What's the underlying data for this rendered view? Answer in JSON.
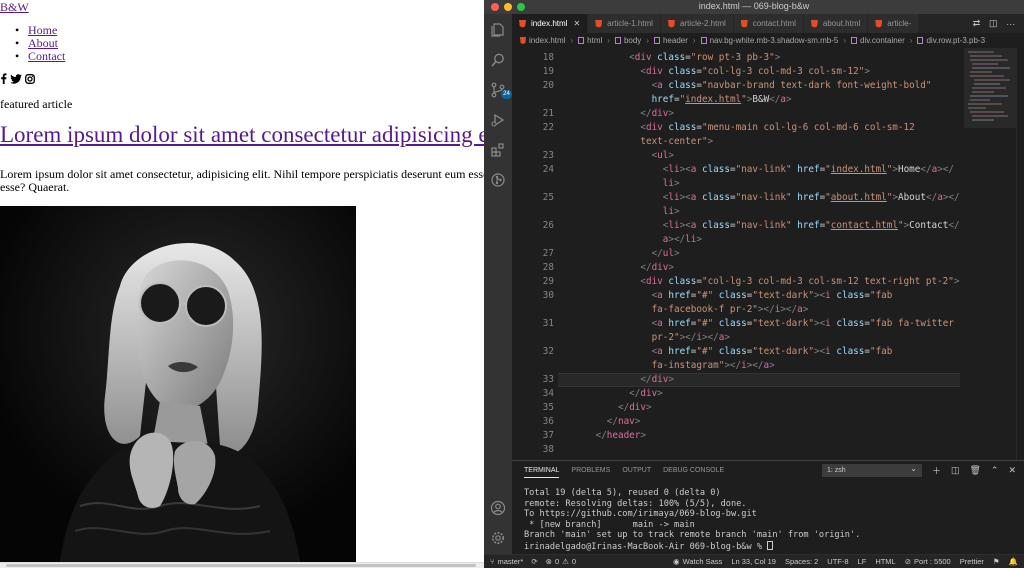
{
  "browser": {
    "brand": "B&W",
    "nav_items": [
      "Home",
      "About",
      "Contact"
    ],
    "social_icons": [
      "facebook-icon",
      "twitter-icon",
      "instagram-icon"
    ],
    "featured_label": "featured article",
    "headline": "Lorem ipsum dolor sit amet consectetur adipisicing elit.",
    "lead": "Lorem ipsum dolor sit amet consectetur, adipisicing elit. Nihil tempore perspiciatis deserunt eum esse animi. Quis, esse? Quaerat."
  },
  "vscode": {
    "window_title": "index.html — 069-blog-b&w",
    "tabs": [
      {
        "label": "index.html",
        "active": true
      },
      {
        "label": "article-1.html",
        "active": false
      },
      {
        "label": "article-2.html",
        "active": false
      },
      {
        "label": "contact.html",
        "active": false
      },
      {
        "label": "about.html",
        "active": false
      },
      {
        "label": "article-",
        "active": false
      }
    ],
    "scm_badge": "24",
    "breadcrumb": [
      "index.html",
      "html",
      "body",
      "header",
      "nav.bg-white.mb-3.shadow-sm.mb-5",
      "div.container",
      "div.row.pt-3.pb-3"
    ],
    "code_lines": [
      {
        "n": "18",
        "t": [
          [
            "            ",
            ""
          ],
          [
            "<",
            "pun"
          ],
          [
            "div",
            "tag"
          ],
          [
            " class",
            "attr"
          ],
          [
            "=",
            "text"
          ],
          [
            "\"row pt-3 pb-3\"",
            "str"
          ],
          [
            ">",
            "pun"
          ]
        ]
      },
      {
        "n": "19",
        "t": [
          [
            "              ",
            ""
          ],
          [
            "<",
            "pun"
          ],
          [
            "div",
            "tag"
          ],
          [
            " class",
            "attr"
          ],
          [
            "=",
            "text"
          ],
          [
            "\"col-lg-3 col-md-3 col-sm-12\"",
            "str"
          ],
          [
            ">",
            "pun"
          ]
        ]
      },
      {
        "n": "20",
        "t": [
          [
            "                ",
            ""
          ],
          [
            "<",
            "pun"
          ],
          [
            "a",
            "tag"
          ],
          [
            " class",
            "attr"
          ],
          [
            "=",
            "text"
          ],
          [
            "\"navbar-brand text-dark font-weight-bold\"",
            "str"
          ]
        ]
      },
      {
        "n": "",
        "t": [
          [
            "                ",
            ""
          ],
          [
            "href",
            "attr"
          ],
          [
            "=",
            "text"
          ],
          [
            "\"",
            "str"
          ],
          [
            "index.html",
            "link"
          ],
          [
            "\"",
            "str"
          ],
          [
            ">",
            "pun"
          ],
          [
            "B&W",
            "text"
          ],
          [
            "</",
            "pun"
          ],
          [
            "a",
            "tag"
          ],
          [
            ">",
            "pun"
          ]
        ]
      },
      {
        "n": "21",
        "t": [
          [
            "              ",
            ""
          ],
          [
            "</",
            "pun"
          ],
          [
            "div",
            "tag"
          ],
          [
            ">",
            "pun"
          ]
        ]
      },
      {
        "n": "22",
        "t": [
          [
            "              ",
            ""
          ],
          [
            "<",
            "pun"
          ],
          [
            "div",
            "tag"
          ],
          [
            " class",
            "attr"
          ],
          [
            "=",
            "text"
          ],
          [
            "\"menu-main col-lg-6 col-md-6 col-sm-12",
            "str"
          ]
        ]
      },
      {
        "n": "",
        "t": [
          [
            "              ",
            ""
          ],
          [
            "text-center\"",
            "str"
          ],
          [
            ">",
            "pun"
          ]
        ]
      },
      {
        "n": "23",
        "t": [
          [
            "                ",
            ""
          ],
          [
            "<",
            "pun"
          ],
          [
            "ul",
            "tag"
          ],
          [
            ">",
            "pun"
          ]
        ]
      },
      {
        "n": "24",
        "t": [
          [
            "                  ",
            ""
          ],
          [
            "<",
            "pun"
          ],
          [
            "li",
            "tag"
          ],
          [
            "><",
            "pun"
          ],
          [
            "a",
            "tag"
          ],
          [
            " class",
            "attr"
          ],
          [
            "=",
            "text"
          ],
          [
            "\"nav-link\"",
            "str"
          ],
          [
            " href",
            "attr"
          ],
          [
            "=",
            "text"
          ],
          [
            "\"",
            "str"
          ],
          [
            "index.html",
            "link"
          ],
          [
            "\"",
            "str"
          ],
          [
            ">",
            "pun"
          ],
          [
            "Home",
            "text"
          ],
          [
            "</",
            "pun"
          ],
          [
            "a",
            "tag"
          ],
          [
            "></",
            "pun"
          ]
        ]
      },
      {
        "n": "",
        "t": [
          [
            "                  ",
            ""
          ],
          [
            "li",
            "tag"
          ],
          [
            ">",
            "pun"
          ]
        ]
      },
      {
        "n": "25",
        "t": [
          [
            "                  ",
            ""
          ],
          [
            "<",
            "pun"
          ],
          [
            "li",
            "tag"
          ],
          [
            "><",
            "pun"
          ],
          [
            "a",
            "tag"
          ],
          [
            " class",
            "attr"
          ],
          [
            "=",
            "text"
          ],
          [
            "\"nav-link\"",
            "str"
          ],
          [
            " href",
            "attr"
          ],
          [
            "=",
            "text"
          ],
          [
            "\"",
            "str"
          ],
          [
            "about.html",
            "link"
          ],
          [
            "\"",
            "str"
          ],
          [
            ">",
            "pun"
          ],
          [
            "About",
            "text"
          ],
          [
            "</",
            "pun"
          ],
          [
            "a",
            "tag"
          ],
          [
            "></",
            "pun"
          ]
        ]
      },
      {
        "n": "",
        "t": [
          [
            "                  ",
            ""
          ],
          [
            "li",
            "tag"
          ],
          [
            ">",
            "pun"
          ]
        ]
      },
      {
        "n": "26",
        "t": [
          [
            "                  ",
            ""
          ],
          [
            "<",
            "pun"
          ],
          [
            "li",
            "tag"
          ],
          [
            "><",
            "pun"
          ],
          [
            "a",
            "tag"
          ],
          [
            " class",
            "attr"
          ],
          [
            "=",
            "text"
          ],
          [
            "\"nav-link\"",
            "str"
          ],
          [
            " href",
            "attr"
          ],
          [
            "=",
            "text"
          ],
          [
            "\"",
            "str"
          ],
          [
            "contact.html",
            "link"
          ],
          [
            "\"",
            "str"
          ],
          [
            ">",
            "pun"
          ],
          [
            "Contact",
            "text"
          ],
          [
            "</",
            "pun"
          ]
        ]
      },
      {
        "n": "",
        "t": [
          [
            "                  ",
            ""
          ],
          [
            "a",
            "tag"
          ],
          [
            "></",
            "pun"
          ],
          [
            "li",
            "tag"
          ],
          [
            ">",
            "pun"
          ]
        ]
      },
      {
        "n": "27",
        "t": [
          [
            "                ",
            ""
          ],
          [
            "</",
            "pun"
          ],
          [
            "ul",
            "tag"
          ],
          [
            ">",
            "pun"
          ]
        ]
      },
      {
        "n": "28",
        "t": [
          [
            "              ",
            ""
          ],
          [
            "</",
            "pun"
          ],
          [
            "div",
            "tag"
          ],
          [
            ">",
            "pun"
          ]
        ]
      },
      {
        "n": "29",
        "t": [
          [
            "              ",
            ""
          ],
          [
            "<",
            "pun"
          ],
          [
            "div",
            "tag"
          ],
          [
            " class",
            "attr"
          ],
          [
            "=",
            "text"
          ],
          [
            "\"col-lg-3 col-md-3 col-sm-12 text-right pt-2\"",
            "str"
          ],
          [
            ">",
            "pun"
          ]
        ]
      },
      {
        "n": "30",
        "t": [
          [
            "                ",
            ""
          ],
          [
            "<",
            "pun"
          ],
          [
            "a",
            "tag"
          ],
          [
            " href",
            "attr"
          ],
          [
            "=",
            "text"
          ],
          [
            "\"#\"",
            "str"
          ],
          [
            " class",
            "attr"
          ],
          [
            "=",
            "text"
          ],
          [
            "\"text-dark\"",
            "str"
          ],
          [
            "><",
            "pun"
          ],
          [
            "i",
            "tag"
          ],
          [
            " class",
            "attr"
          ],
          [
            "=",
            "text"
          ],
          [
            "\"fab",
            "str"
          ]
        ]
      },
      {
        "n": "",
        "t": [
          [
            "                ",
            ""
          ],
          [
            "fa-facebook-f pr-2\"",
            "str"
          ],
          [
            "></",
            "pun"
          ],
          [
            "i",
            "tag"
          ],
          [
            "></",
            "pun"
          ],
          [
            "a",
            "tag"
          ],
          [
            ">",
            "pun"
          ]
        ]
      },
      {
        "n": "31",
        "t": [
          [
            "                ",
            ""
          ],
          [
            "<",
            "pun"
          ],
          [
            "a",
            "tag"
          ],
          [
            " href",
            "attr"
          ],
          [
            "=",
            "text"
          ],
          [
            "\"#\"",
            "str"
          ],
          [
            " class",
            "attr"
          ],
          [
            "=",
            "text"
          ],
          [
            "\"text-dark\"",
            "str"
          ],
          [
            "><",
            "pun"
          ],
          [
            "i",
            "tag"
          ],
          [
            " class",
            "attr"
          ],
          [
            "=",
            "text"
          ],
          [
            "\"fab fa-twitter",
            "str"
          ]
        ]
      },
      {
        "n": "",
        "t": [
          [
            "                ",
            ""
          ],
          [
            "pr-2\"",
            "str"
          ],
          [
            "></",
            "pun"
          ],
          [
            "i",
            "tag"
          ],
          [
            "></",
            "pun"
          ],
          [
            "a",
            "tag"
          ],
          [
            ">",
            "pun"
          ]
        ]
      },
      {
        "n": "32",
        "t": [
          [
            "                ",
            ""
          ],
          [
            "<",
            "pun"
          ],
          [
            "a",
            "tag"
          ],
          [
            " href",
            "attr"
          ],
          [
            "=",
            "text"
          ],
          [
            "\"#\"",
            "str"
          ],
          [
            " class",
            "attr"
          ],
          [
            "=",
            "text"
          ],
          [
            "\"text-dark\"",
            "str"
          ],
          [
            "><",
            "pun"
          ],
          [
            "i",
            "tag"
          ],
          [
            " class",
            "attr"
          ],
          [
            "=",
            "text"
          ],
          [
            "\"fab",
            "str"
          ]
        ]
      },
      {
        "n": "",
        "t": [
          [
            "                ",
            ""
          ],
          [
            "fa-instagram\"",
            "str"
          ],
          [
            "></",
            "pun"
          ],
          [
            "i",
            "tag"
          ],
          [
            "></",
            "pun"
          ],
          [
            "a",
            "tag"
          ],
          [
            ">",
            "pun"
          ]
        ]
      },
      {
        "n": "33",
        "t": [
          [
            "              ",
            ""
          ],
          [
            "</",
            "pun"
          ],
          [
            "div",
            "tag"
          ],
          [
            ">",
            "pun"
          ]
        ]
      },
      {
        "n": "34",
        "t": [
          [
            "            ",
            ""
          ],
          [
            "</",
            "pun"
          ],
          [
            "div",
            "tag"
          ],
          [
            ">",
            "pun"
          ]
        ]
      },
      {
        "n": "35",
        "t": [
          [
            "          ",
            ""
          ],
          [
            "</",
            "pun"
          ],
          [
            "div",
            "tag"
          ],
          [
            ">",
            "pun"
          ]
        ]
      },
      {
        "n": "36",
        "t": [
          [
            "        ",
            ""
          ],
          [
            "</",
            "pun"
          ],
          [
            "nav",
            "tag"
          ],
          [
            ">",
            "pun"
          ]
        ]
      },
      {
        "n": "37",
        "t": [
          [
            "      ",
            ""
          ],
          [
            "</",
            "pun"
          ],
          [
            "header",
            "tag"
          ],
          [
            ">",
            "pun"
          ]
        ]
      },
      {
        "n": "38",
        "t": [
          [
            "",
            ""
          ]
        ]
      }
    ],
    "current_line": "33",
    "panel": {
      "tabs": [
        "TERMINAL",
        "PROBLEMS",
        "OUTPUT",
        "DEBUG CONSOLE"
      ],
      "active_tab": "TERMINAL",
      "shell": "1: zsh",
      "terminal_lines": [
        "Total 19 (delta 5), reused 0 (delta 0)",
        "remote: Resolving deltas: 100% (5/5), done.",
        "To https://github.com/irimaya/069-blog-bw.git",
        " * [new branch]      main -> main",
        "Branch 'main' set up to track remote branch 'main' from 'origin'.",
        "irinadelgado@Irinas-MacBook-Air 069-blog-b&w % "
      ]
    },
    "status": {
      "branch": "master*",
      "errors": "0",
      "warnings": "0",
      "watch_sass": "Watch Sass",
      "position": "Ln 33, Col 19",
      "spaces": "Spaces: 2",
      "encoding": "UTF-8",
      "eol": "LF",
      "language": "HTML",
      "port": "Port : 5500",
      "formatter": "Prettier"
    },
    "colors": {
      "editor_bg": "#1e1e1e",
      "activity_bg": "#333333",
      "tag": "#e06c9f",
      "attr": "#9cdcfe",
      "string": "#ce9178",
      "badge": "#0e639c"
    }
  }
}
